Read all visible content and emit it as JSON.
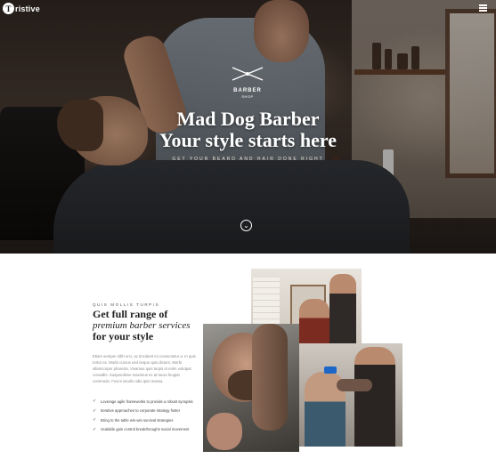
{
  "nav": {
    "logo_mark": "T",
    "logo_text": "ristive",
    "menu_icon": "hamburger-menu-icon"
  },
  "hero": {
    "emblem_title": "BARBER",
    "emblem_subtitle": "SHOP",
    "title_line1": "Mad Dog Barber",
    "title_line2": "Your style starts here",
    "subtitle": "GET YOUR BEARD AND HAIR DONE RIGHT",
    "scroll_icon": "chevron-down-icon"
  },
  "about": {
    "eyebrow": "QUIS MOLLIS TURPIS",
    "heading_line1": "Get full range of",
    "heading_line2": "premium barber services",
    "heading_line3": "for your style",
    "body": "Etiam semper nibh orci, ac tincidunt mi consectetur a. In quis tortor ex. Morbi cursus sed neque quis dictum. Morbi ullamcorper pharetra. Vivamus quis turpis et enim volutpat convallis. Suspendisse maximus ex at lacus feugiat commodo. Fusce iaculis odio quis massa.",
    "features": [
      "Leverage agile frameworks to provide a robust synopsis",
      "Iterative approaches to corporate strategy foster",
      "Bring to the table win-win survival strategies",
      "Scalable gain control breakthroughs social movement"
    ],
    "check_icon": "check-icon"
  }
}
